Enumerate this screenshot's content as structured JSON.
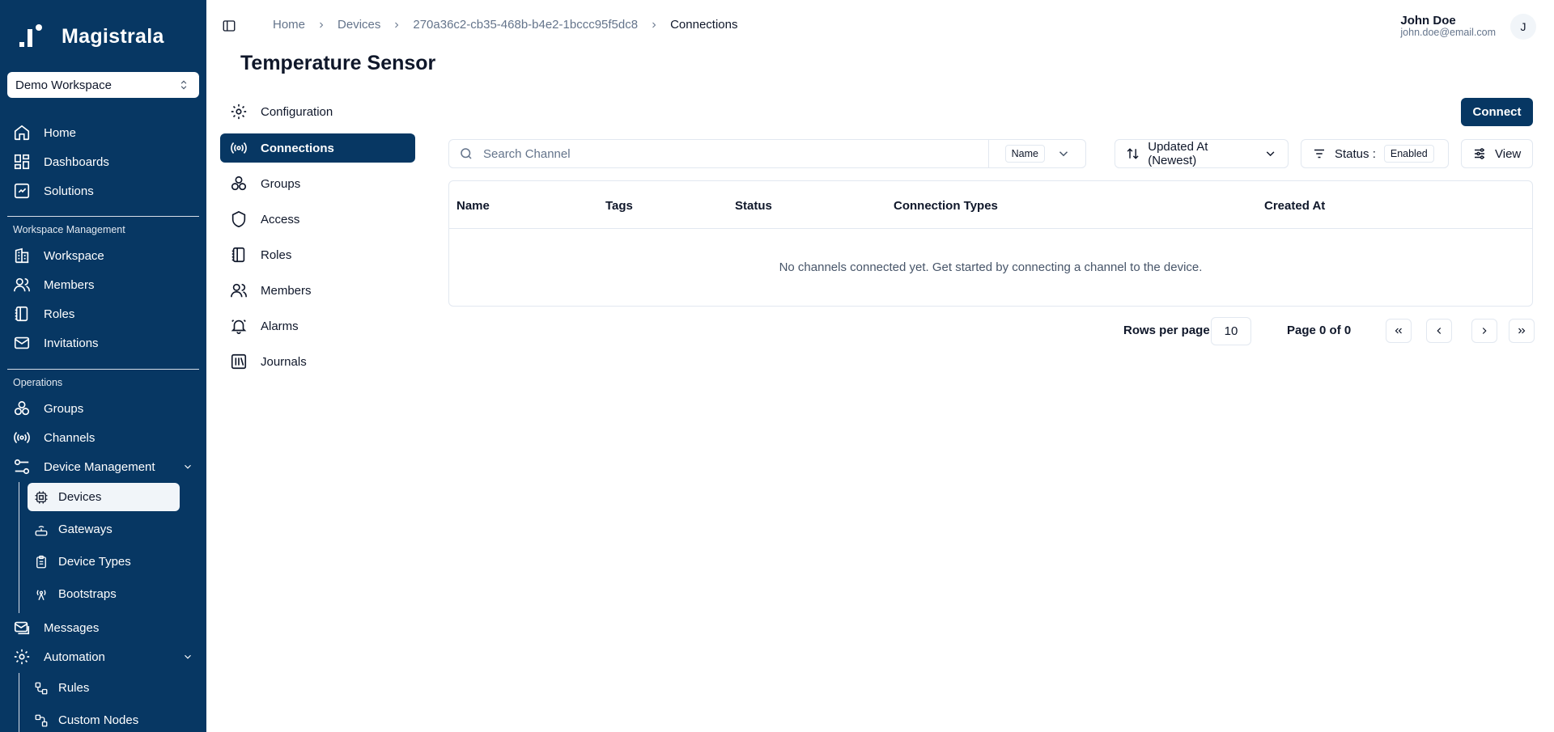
{
  "app": {
    "brand": "Magistrala",
    "workspace": "Demo Workspace"
  },
  "sidebar": {
    "top_items": [
      {
        "label": "Home",
        "icon": "home-icon"
      },
      {
        "label": "Dashboards",
        "icon": "dashboard-icon"
      },
      {
        "label": "Solutions",
        "icon": "solutions-icon"
      }
    ],
    "workspace_section": "Workspace Management",
    "workspace_items": [
      {
        "label": "Workspace",
        "icon": "building-icon"
      },
      {
        "label": "Members",
        "icon": "users-icon"
      },
      {
        "label": "Roles",
        "icon": "notebook-icon"
      },
      {
        "label": "Invitations",
        "icon": "mail-icon"
      }
    ],
    "operations_section": "Operations",
    "operations_items": [
      {
        "label": "Groups",
        "icon": "groups-icon"
      },
      {
        "label": "Channels",
        "icon": "broadcast-icon"
      }
    ],
    "device_management": {
      "label": "Device Management",
      "items": [
        {
          "label": "Devices",
          "icon": "cpu-icon",
          "active": true
        },
        {
          "label": "Gateways",
          "icon": "router-icon"
        },
        {
          "label": "Device Types",
          "icon": "clipboard-icon"
        },
        {
          "label": "Bootstraps",
          "icon": "antenna-icon"
        }
      ]
    },
    "messages": "Messages",
    "automation": {
      "label": "Automation",
      "items": [
        {
          "label": "Rules",
          "icon": "workflow-icon"
        },
        {
          "label": "Custom Nodes",
          "icon": "nodes-icon"
        }
      ]
    }
  },
  "header": {
    "breadcrumbs": [
      "Home",
      "Devices",
      "270a36c2-cb35-468b-b4e2-1bccc95f5dc8",
      "Connections"
    ],
    "user_name": "John Doe",
    "user_email": "john.doe@email.com",
    "avatar_initial": "J"
  },
  "page": {
    "title": "Temperature Sensor",
    "tabs": [
      {
        "label": "Configuration",
        "icon": "gear-icon"
      },
      {
        "label": "Connections",
        "icon": "broadcast-icon",
        "active": true
      },
      {
        "label": "Groups",
        "icon": "groups-icon"
      },
      {
        "label": "Access",
        "icon": "shield-icon"
      },
      {
        "label": "Roles",
        "icon": "notebook-icon"
      },
      {
        "label": "Members",
        "icon": "users-icon"
      },
      {
        "label": "Alarms",
        "icon": "bell-icon"
      },
      {
        "label": "Journals",
        "icon": "journal-icon"
      }
    ],
    "connect_button": "Connect",
    "search": {
      "placeholder": "Search Channel",
      "filter_field": "Name"
    },
    "sort_label": "Updated At (Newest)",
    "status_label": "Status :",
    "status_value": "Enabled",
    "view_label": "View",
    "table": {
      "columns": [
        "Name",
        "Tags",
        "Status",
        "Connection Types",
        "Created At"
      ],
      "empty_message": "No channels connected yet. Get started by connecting a channel to the device."
    },
    "pagination": {
      "rows_per_page_label": "Rows per page",
      "rows_per_page": "10",
      "page_info": "Page 0 of 0"
    }
  },
  "colors": {
    "sidebar_bg": "#073763",
    "accent": "#073763",
    "border": "#e2e8f0"
  }
}
